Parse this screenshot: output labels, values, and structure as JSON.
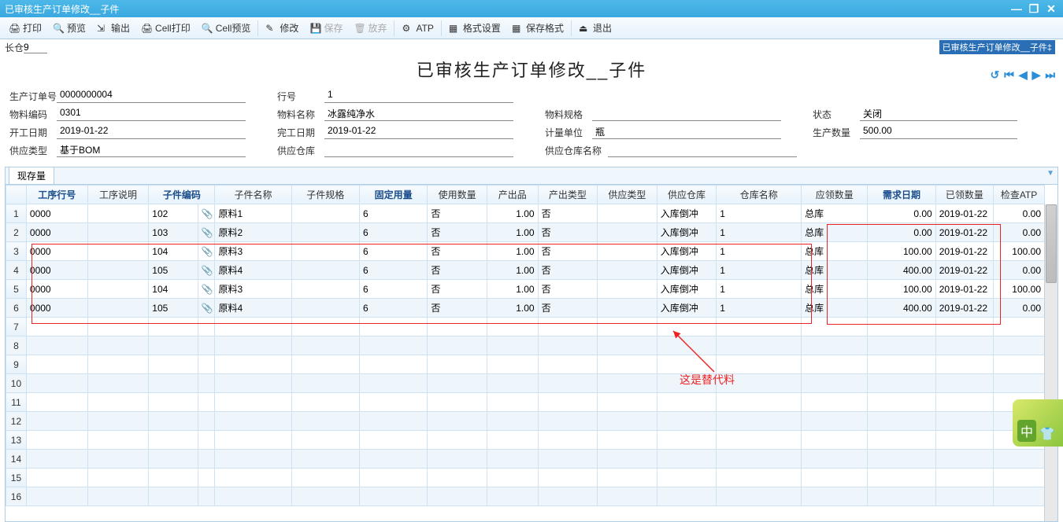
{
  "window": {
    "title": "已审核生产订单修改__子件"
  },
  "toolbar": {
    "print": "打印",
    "preview": "预览",
    "output": "输出",
    "cellPrint": "Cell打印",
    "cellPreview": "Cell预览",
    "modify": "修改",
    "save": "保存",
    "discard": "放弃",
    "atp": "ATP",
    "formatSet": "格式设置",
    "saveFormat": "保存格式",
    "exit": "退出"
  },
  "subbar": {
    "leftLabel": "长仓",
    "leftValue": "9",
    "rightTag": "已审核生产订单修改__子件‡"
  },
  "pageTitle": "已审核生产订单修改__子件",
  "form": {
    "r1": {
      "orderNoLbl": "生产订单号",
      "orderNo": "0000000004",
      "lineNoLbl": "行号",
      "lineNo": "1"
    },
    "r2": {
      "matCodeLbl": "物料编码",
      "matCode": "0301",
      "matNameLbl": "物料名称",
      "matName": "冰露纯净水",
      "matSpecLbl": "物料规格",
      "matSpec": "",
      "statusLbl": "状态",
      "status": "关闭"
    },
    "r3": {
      "startLbl": "开工日期",
      "start": "2019-01-22",
      "endLbl": "完工日期",
      "end": "2019-01-22",
      "uomLbl": "计量单位",
      "uom": "瓶",
      "qtyLbl": "生产数量",
      "qty": "500.00"
    },
    "r4": {
      "supplyTypeLbl": "供应类型",
      "supplyType": "基于BOM",
      "supplyWhLbl": "供应仓库",
      "supplyWh": "",
      "supplyWhNameLbl": "供应仓库名称",
      "supplyWhName": ""
    }
  },
  "tab": {
    "label": "现存量"
  },
  "grid": {
    "headers": {
      "opLine": "工序行号",
      "opDesc": "工序说明",
      "childCode": "子件编码",
      "childName": "子件名称",
      "childSpec": "子件规格",
      "fixedQty": "固定用量",
      "useQty": "使用数量",
      "output": "产出品",
      "outputType": "产出类型",
      "supplyType": "供应类型",
      "supplyWh": "供应仓库",
      "whName": "仓库名称",
      "shouldQty": "应领数量",
      "reqDate": "需求日期",
      "issuedQty": "已领数量",
      "checkAtp": "检查ATP"
    },
    "rows": [
      {
        "op": "0000",
        "code": "102",
        "name": "原料1",
        "fixed": "6",
        "output": "否",
        "useQty": "1.00",
        "isOut": "否",
        "supplyType": "入库倒冲",
        "wh": "1",
        "whName": "总库",
        "should": "0.00",
        "reqDate": "2019-01-22",
        "issued": "0.00"
      },
      {
        "op": "0000",
        "code": "103",
        "name": "原料2",
        "fixed": "6",
        "output": "否",
        "useQty": "1.00",
        "isOut": "否",
        "supplyType": "入库倒冲",
        "wh": "1",
        "whName": "总库",
        "should": "0.00",
        "reqDate": "2019-01-22",
        "issued": "0.00"
      },
      {
        "op": "0000",
        "code": "104",
        "name": "原料3",
        "fixed": "6",
        "output": "否",
        "useQty": "1.00",
        "isOut": "否",
        "supplyType": "入库倒冲",
        "wh": "1",
        "whName": "总库",
        "should": "100.00",
        "reqDate": "2019-01-22",
        "issued": "100.00"
      },
      {
        "op": "0000",
        "code": "105",
        "name": "原料4",
        "fixed": "6",
        "output": "否",
        "useQty": "1.00",
        "isOut": "否",
        "supplyType": "入库倒冲",
        "wh": "1",
        "whName": "总库",
        "should": "400.00",
        "reqDate": "2019-01-22",
        "issued": "0.00"
      },
      {
        "op": "0000",
        "code": "104",
        "name": "原料3",
        "fixed": "6",
        "output": "否",
        "useQty": "1.00",
        "isOut": "否",
        "supplyType": "入库倒冲",
        "wh": "1",
        "whName": "总库",
        "should": "100.00",
        "reqDate": "2019-01-22",
        "issued": "100.00"
      },
      {
        "op": "0000",
        "code": "105",
        "name": "原料4",
        "fixed": "6",
        "output": "否",
        "useQty": "1.00",
        "isOut": "否",
        "supplyType": "入库倒冲",
        "wh": "1",
        "whName": "总库",
        "should": "400.00",
        "reqDate": "2019-01-22",
        "issued": "0.00"
      }
    ],
    "emptyRows": 10
  },
  "annotation": {
    "text": "这是替代料"
  },
  "ime": {
    "char": "中"
  }
}
